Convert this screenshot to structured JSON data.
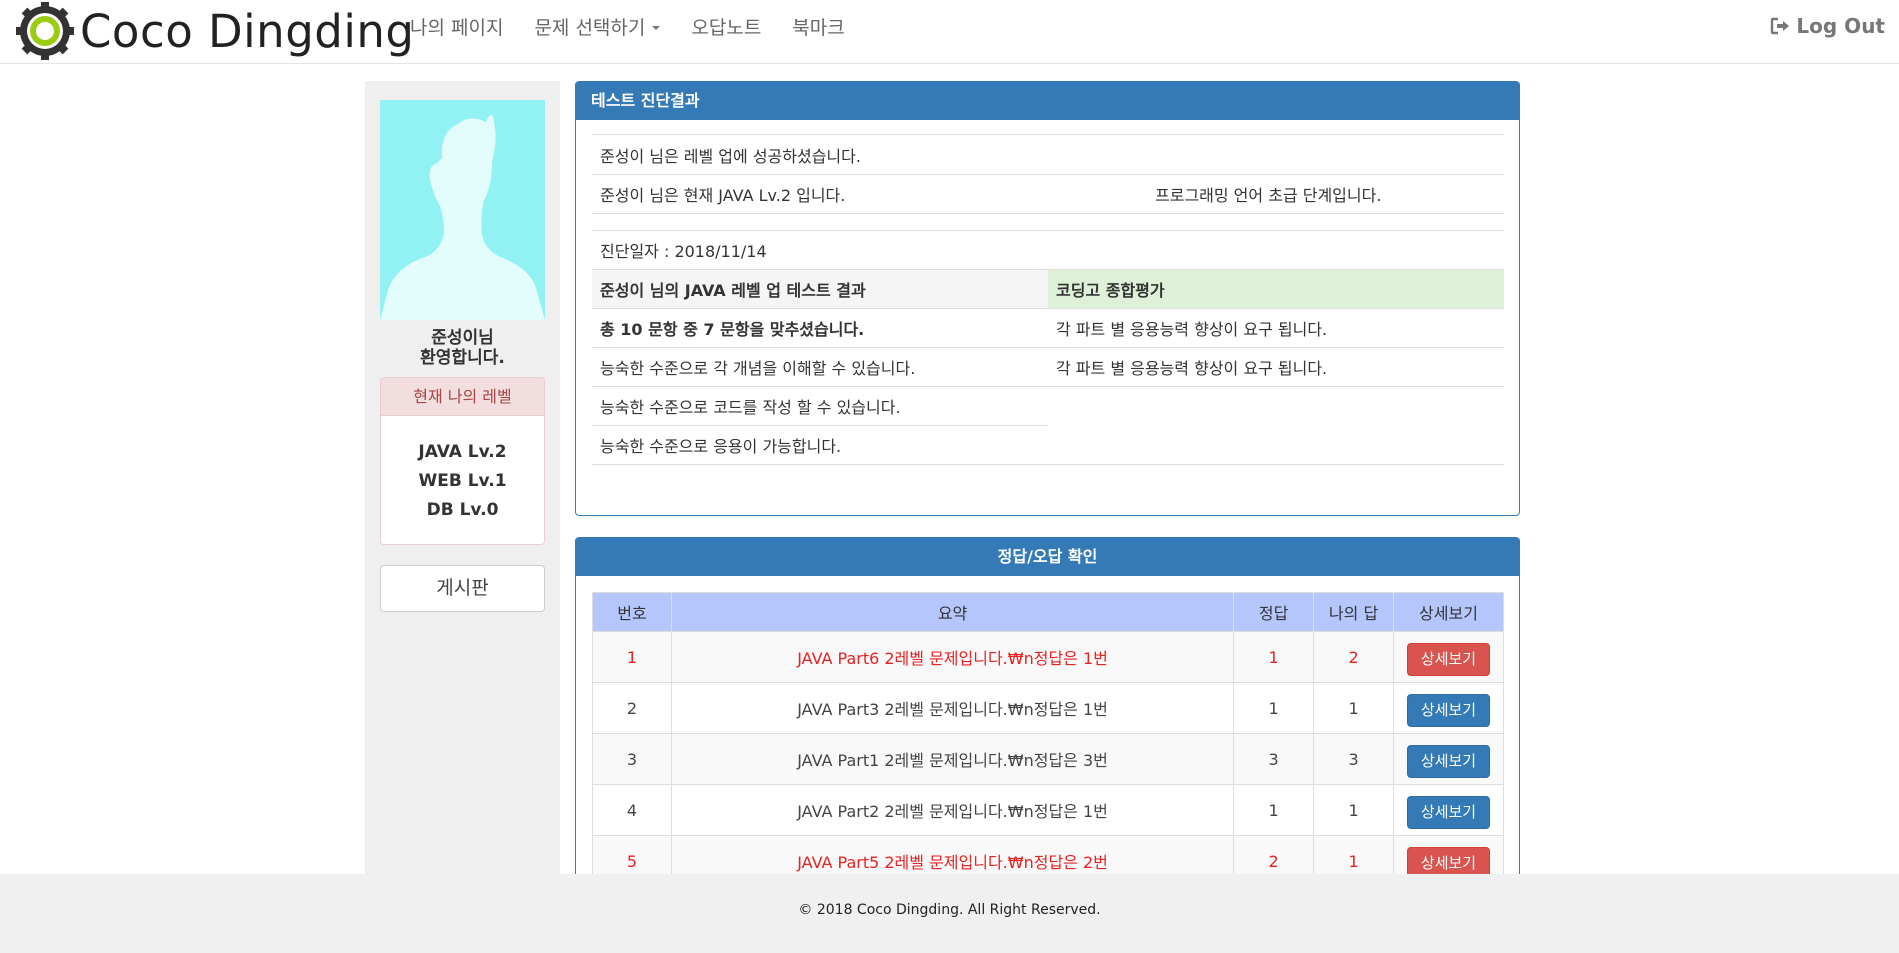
{
  "brand": {
    "name": "Coco Dingding"
  },
  "nav": {
    "items": [
      "나의 페이지",
      "문제 선택하기",
      "오답노트",
      "북마크"
    ],
    "logout_label": "Log Out"
  },
  "sidebar": {
    "welcome_name": "준성이님",
    "welcome_text": "환영합니다.",
    "level_title": "현재 나의 레벨",
    "levels": [
      "JAVA Lv.2",
      "WEB Lv.1",
      "DB Lv.0"
    ],
    "board_label": "게시판"
  },
  "diagnosis": {
    "title": "테스트 진단결과",
    "levelup_msg": "준성이 님은 레벨 업에 성공하셨습니다.",
    "current_level_msg": "준성이 님은 현재 JAVA Lv.2 입니다.",
    "stage_msg": "프로그래밍 언어 초급 단계입니다.",
    "date_text": "진단일자 : 2018/11/14",
    "result_header": "준성이 님의 JAVA 레벨 업 테스트 결과",
    "eval_header": "코딩고 종합평가",
    "score_msg": "총 10 문항 중 7 문항을 맞추셨습니다.",
    "left_items": [
      "능숙한 수준으로 각 개념을 이해할 수 있습니다.",
      "능숙한 수준으로 코드를 작성 할 수 있습니다.",
      "능숙한 수준으로 응용이 가능합니다."
    ],
    "right_items": [
      "각 파트 별 응용능력 향상이 요구 됩니다.",
      "각 파트 별 응용능력 향상이 요구 됩니다."
    ]
  },
  "answers": {
    "title": "정답/오답 확인",
    "headers": [
      "번호",
      "요약",
      "정답",
      "나의 답",
      "상세보기"
    ],
    "detail_label": "상세보기",
    "rows": [
      {
        "no": "1",
        "summary": "JAVA Part6 2레벨 문제입니다.₩n정답은 1번",
        "correct": "1",
        "mine": "2",
        "wrong": true
      },
      {
        "no": "2",
        "summary": "JAVA Part3 2레벨 문제입니다.₩n정답은 1번",
        "correct": "1",
        "mine": "1",
        "wrong": false
      },
      {
        "no": "3",
        "summary": "JAVA Part1 2레벨 문제입니다.₩n정답은 3번",
        "correct": "3",
        "mine": "3",
        "wrong": false
      },
      {
        "no": "4",
        "summary": "JAVA Part2 2레벨 문제입니다.₩n정답은 1번",
        "correct": "1",
        "mine": "1",
        "wrong": false
      },
      {
        "no": "5",
        "summary": "JAVA Part5 2레벨 문제입니다.₩n정답은 2번",
        "correct": "2",
        "mine": "1",
        "wrong": true
      }
    ]
  },
  "footer": {
    "text": "© 2018 Coco Dingding. All Right Reserved."
  },
  "colors": {
    "primary": "#337ab7",
    "danger": "#d9534f",
    "wrong_text": "#e82121",
    "table_header": "#b5c6fd",
    "eval_header": "#dff0d8",
    "avatar_bg": "#92f1f3"
  }
}
